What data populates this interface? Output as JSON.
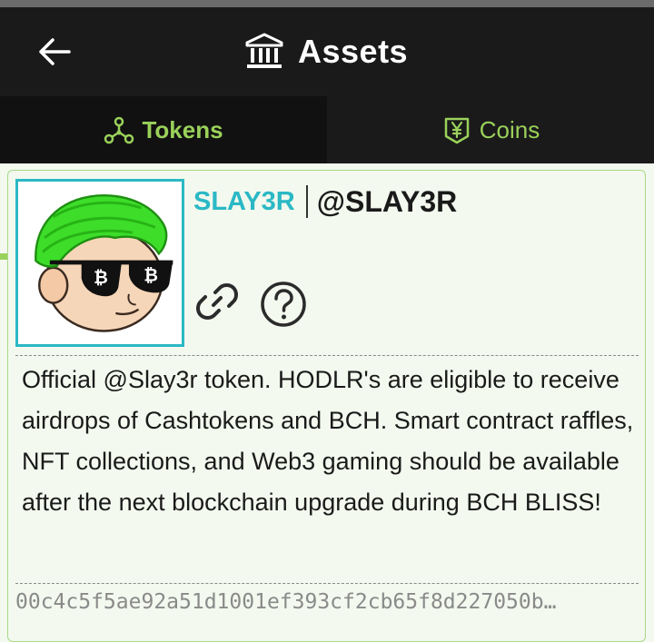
{
  "header": {
    "title": "Assets",
    "title_icon": "bank-icon",
    "back_icon": "arrow-left-icon"
  },
  "tabs": [
    {
      "label": "Tokens",
      "icon": "molecule-icon",
      "active": true
    },
    {
      "label": "Coins",
      "icon": "yen-coin-icon",
      "active": false
    }
  ],
  "token": {
    "name": "SLAY3R",
    "handle": "@SLAY3R",
    "description": "Official @Slay3r token. HODLR's are eligible to receive airdrops of Cashtokens and BCH. Smart contract raffles, NFT collections, and Web3 gaming should be available after the next blockchain upgrade during BCH BLISS!",
    "token_id": "00c4c5f5ae92a51d1001ef393cf2cb65f8d227050b…",
    "actions": {
      "link_icon": "link-icon",
      "help_icon": "question-circle-icon"
    }
  },
  "colors": {
    "accent": "#9ad15a",
    "token_name": "#2bb8c5",
    "header_bg": "#1a1a1a",
    "card_bg": "#f3f9ee"
  }
}
